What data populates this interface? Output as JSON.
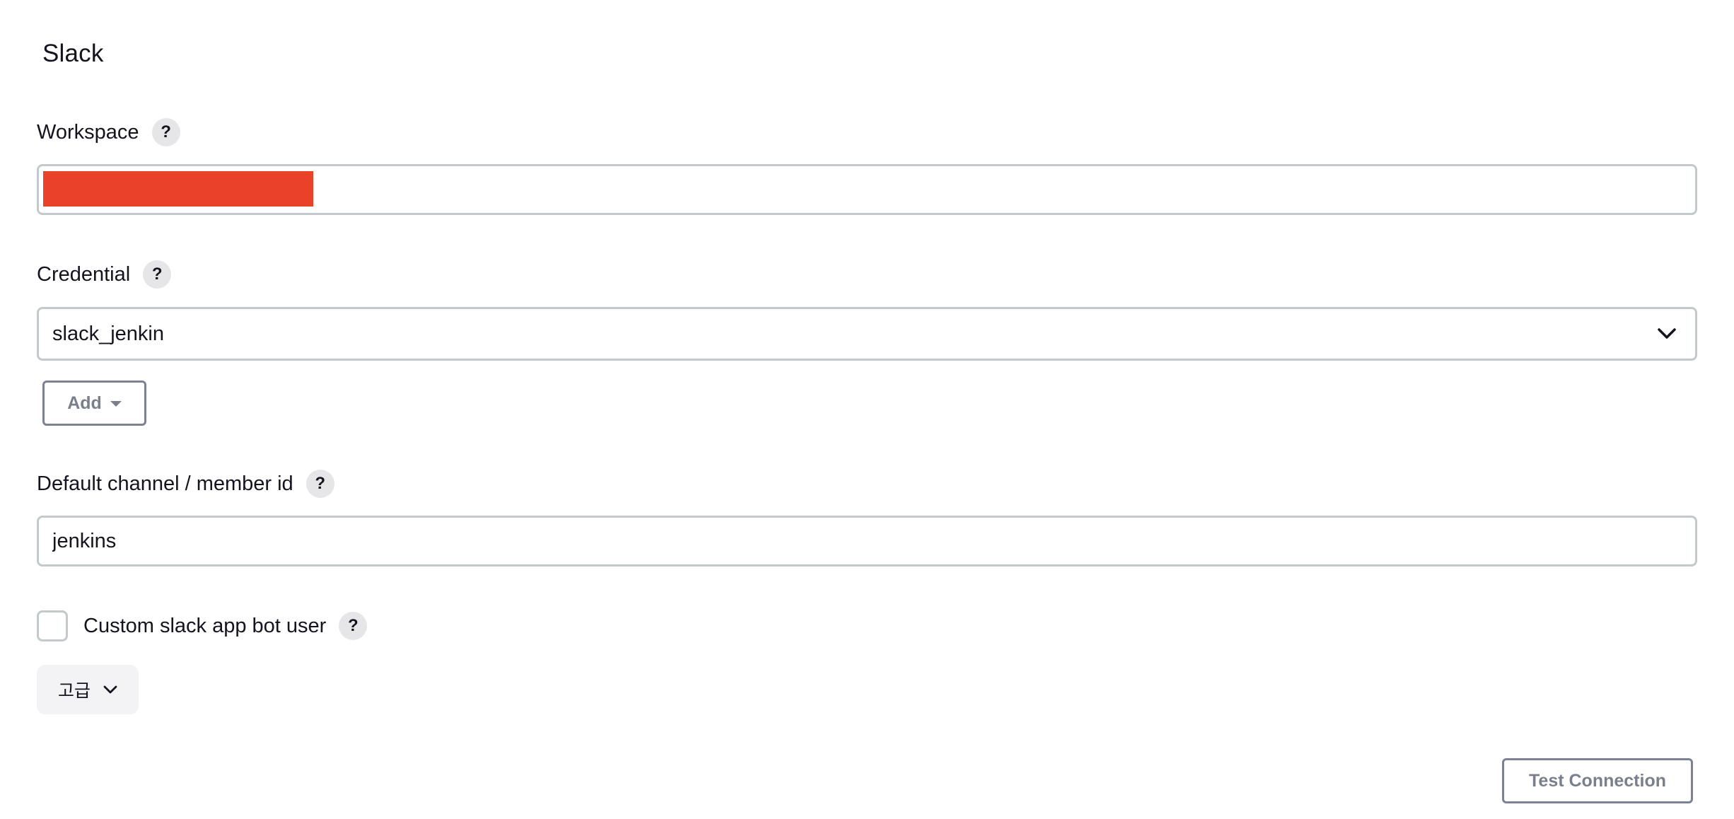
{
  "section": {
    "title": "Slack"
  },
  "workspace": {
    "label": "Workspace",
    "help": "?",
    "value": ""
  },
  "credential": {
    "label": "Credential",
    "help": "?",
    "selected": "slack_jenkin",
    "add_label": "Add"
  },
  "channel": {
    "label": "Default channel / member id",
    "help": "?",
    "value": "jenkins"
  },
  "bot_user": {
    "label": "Custom slack app bot user",
    "help": "?",
    "checked": false
  },
  "advanced": {
    "label": "고급"
  },
  "test": {
    "label": "Test Connection"
  },
  "colors": {
    "redaction": "#ea4129",
    "input_border": "#c3cacc",
    "button_border": "#7d8290",
    "help_bg": "#e6e6e9"
  },
  "icons": {
    "select_chevron": "chevron-down-icon",
    "add_caret": "caret-down-icon",
    "advanced_chevron": "chevron-down-icon"
  }
}
